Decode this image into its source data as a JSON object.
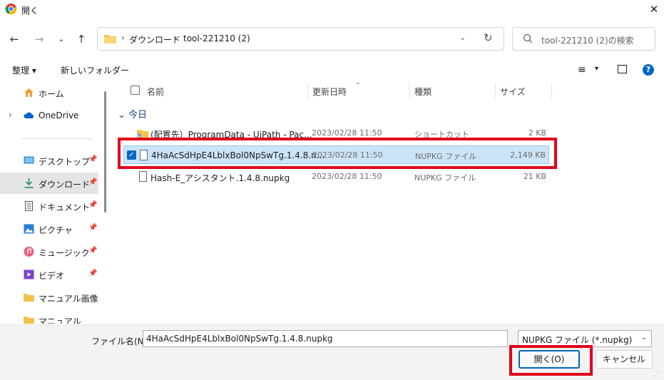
{
  "window": {
    "title": "開く",
    "close_glyph": "✕"
  },
  "nav": {
    "back_glyph": "←",
    "forward_glyph": "→",
    "recent_glyph": "⌄",
    "up_glyph": "↑"
  },
  "address": {
    "crumbs": [
      "ダウンロード",
      "tool-221210 (2)"
    ],
    "separator": "›",
    "dropdown_glyph": "⌄",
    "refresh_glyph": "↻"
  },
  "search": {
    "placeholder": "tool-221210 (2)の検索"
  },
  "toolbar": {
    "organize_label": "整理 ▾",
    "new_folder_label": "新しいフォルダー",
    "view_glyph": "≡",
    "view_dropdown_glyph": "▾",
    "help_glyph": "?"
  },
  "sidebar": {
    "items": [
      {
        "label": "ホーム",
        "icon": "home-icon",
        "pinned": false
      },
      {
        "label": "OneDrive",
        "icon": "cloud-icon",
        "pinned": false,
        "expand": "›"
      },
      {
        "label": "デスクトップ",
        "icon": "desktop-icon",
        "pinned": true
      },
      {
        "label": "ダウンロード",
        "icon": "download-icon",
        "pinned": true,
        "selected": true
      },
      {
        "label": "ドキュメント",
        "icon": "document-icon",
        "pinned": true
      },
      {
        "label": "ピクチャ",
        "icon": "pictures-icon",
        "pinned": true
      },
      {
        "label": "ミュージック",
        "icon": "music-icon",
        "pinned": true
      },
      {
        "label": "ビデオ",
        "icon": "video-icon",
        "pinned": true
      },
      {
        "label": "マニュアル画像",
        "icon": "folder-icon",
        "pinned": false
      },
      {
        "label": "マニュアル",
        "icon": "folder-icon",
        "pinned": false
      }
    ],
    "pin_glyph": "📌"
  },
  "filelist": {
    "columns": [
      "名前",
      "更新日時",
      "種類",
      "サイズ"
    ],
    "sort_glyph": "⌄",
    "group_label": "⌄ 今日",
    "rows": [
      {
        "name": "(配置先）ProgramData - UiPath - Pac...",
        "date": "2023/02/28 11:50",
        "type": "ショートカット",
        "size": "2 KB",
        "icon": "shortcut-folder-icon"
      },
      {
        "name": "4HaAcSdHpE4LblxBol0NpSwTg.1.4.8.n...",
        "date": "2023/02/28 11:50",
        "type": "NUPKG ファイル",
        "size": "2,149 KB",
        "icon": "file-icon",
        "selected": true
      },
      {
        "name": "Hash-E_アシスタント.1.4.8.nupkg",
        "date": "2023/02/28 11:50",
        "type": "NUPKG ファイル",
        "size": "21 KB",
        "icon": "file-icon"
      }
    ],
    "check_glyph": "✓"
  },
  "footer": {
    "filename_label": "ファイル名(N):",
    "filename_value": "4HaAcSdHpE4LblxBol0NpSwTg.1.4.8.nupkg",
    "filetype_value": "NUPKG ファイル (*.nupkg)",
    "filetype_glyph": "⌄",
    "open_label": "開く(O)",
    "cancel_label": "キャンセル"
  },
  "colors": {
    "accent": "#0067c0",
    "selection": "#cce4f7",
    "highlight": "#e0001b",
    "folder": "#f3c44d"
  }
}
